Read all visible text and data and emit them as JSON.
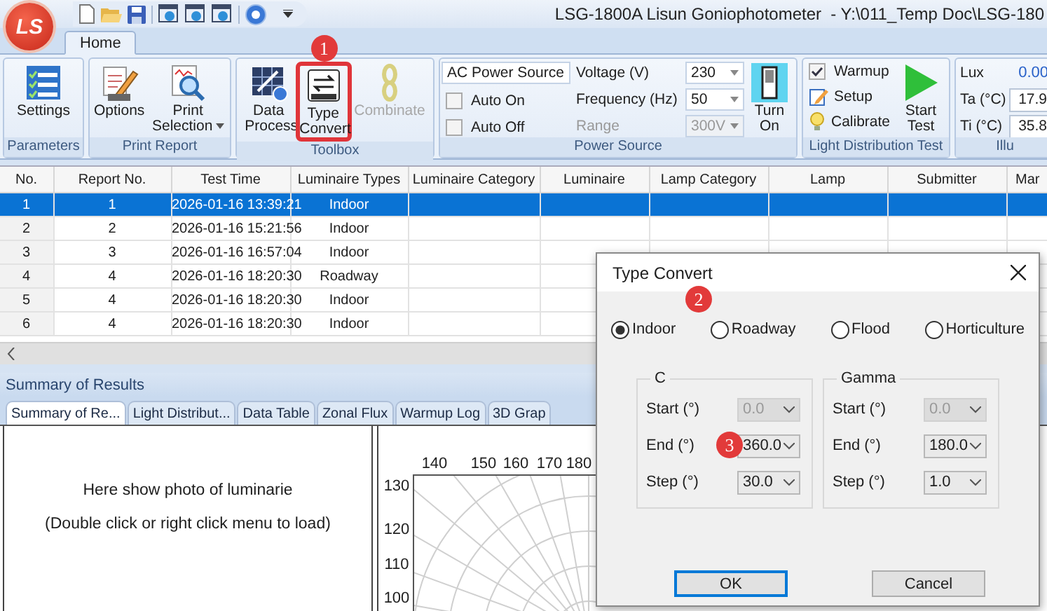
{
  "title_bar": {
    "logo": "LS",
    "title": "LSG-1800A Lisun Goniophotometer  - Y:\\011_Temp Doc\\LSG-180"
  },
  "ribbon_tabs": [
    {
      "label": "Home",
      "selected": true
    }
  ],
  "ribbon_groups": [
    {
      "kind": "buttons",
      "label": "Parameters",
      "buttons": [
        {
          "kind": "settings",
          "label": "Settings",
          "disabled": false,
          "dropdown": false,
          "highlighted": false
        }
      ]
    },
    {
      "kind": "buttons",
      "label": "Print Report",
      "buttons": [
        {
          "kind": "options",
          "label": "Options",
          "disabled": false,
          "dropdown": false,
          "highlighted": false
        },
        {
          "kind": "print",
          "label": "Print Selection",
          "disabled": false,
          "dropdown": true,
          "highlighted": false
        }
      ]
    },
    {
      "kind": "buttons",
      "label": "Toolbox",
      "buttons": [
        {
          "kind": "data",
          "label": "Data Process",
          "disabled": false,
          "dropdown": false,
          "highlighted": false
        },
        {
          "kind": "convert",
          "label": "Type Convert",
          "disabled": false,
          "dropdown": false,
          "highlighted": true,
          "badge": "1"
        },
        {
          "kind": "combinate",
          "label": "Combinate",
          "disabled": true,
          "dropdown": false,
          "highlighted": false
        }
      ]
    },
    {
      "kind": "power",
      "label": "Power Source",
      "source": "AC Power Source",
      "checks": [
        {
          "label": "Auto On",
          "checked": false
        },
        {
          "label": "Auto Off",
          "checked": false
        }
      ],
      "fields": [
        {
          "label": "Voltage (V)",
          "value": "230",
          "disabled": false
        },
        {
          "label": "Frequency (Hz)",
          "value": "50",
          "disabled": false
        },
        {
          "label": "Range",
          "value": "300V",
          "disabled": true
        }
      ],
      "switch": {
        "label": "Turn On"
      }
    },
    {
      "kind": "test",
      "label": "Light Distribution Test",
      "items": [
        {
          "kind": "check",
          "label": "Warmup",
          "checked": true
        },
        {
          "kind": "setup",
          "label": "Setup"
        },
        {
          "kind": "calibrate",
          "label": "Calibrate"
        }
      ],
      "start": {
        "label": "Start Test"
      }
    },
    {
      "kind": "readings",
      "label": "Illu",
      "readings": [
        {
          "kind": "plain",
          "label": "Lux",
          "value": "0.00"
        },
        {
          "kind": "boxed",
          "label": "Ta (°C)",
          "value": "17.9"
        },
        {
          "kind": "boxed",
          "label": "Ti (°C)",
          "value": "35.8"
        }
      ]
    }
  ],
  "table": {
    "columns": [
      "No.",
      "Report No.",
      "Test Time",
      "Luminaire Types",
      "Luminaire Category",
      "Luminaire",
      "Lamp Category",
      "Lamp",
      "Submitter",
      "Mar"
    ],
    "rows": [
      {
        "selected": true,
        "cells": [
          "1",
          "1",
          "2026-01-16 13:39:21",
          "Indoor"
        ]
      },
      {
        "selected": false,
        "cells": [
          "2",
          "2",
          "2026-01-16 15:21:56",
          "Indoor"
        ]
      },
      {
        "selected": false,
        "cells": [
          "3",
          "3",
          "2026-01-16 16:57:04",
          "Indoor"
        ]
      },
      {
        "selected": false,
        "cells": [
          "4",
          "4",
          "2026-01-16 18:20:30",
          "Roadway"
        ]
      },
      {
        "selected": false,
        "cells": [
          "5",
          "4",
          "2026-01-16 18:20:30",
          "Indoor"
        ]
      },
      {
        "selected": false,
        "cells": [
          "6",
          "4",
          "2026-01-16 18:20:30",
          "Indoor"
        ]
      }
    ]
  },
  "summary": {
    "title": "Summary of Results",
    "tabs": [
      {
        "label": "Summary of Re...",
        "selected": true
      },
      {
        "label": "Light Distribut...",
        "selected": false
      },
      {
        "label": "Data Table",
        "selected": false
      },
      {
        "label": "Zonal Flux",
        "selected": false
      },
      {
        "label": "Warmup Log",
        "selected": false
      },
      {
        "label": "3D Grap",
        "selected": false
      }
    ],
    "photo_panel": {
      "lines": [
        "Here show photo of luminarie",
        "(Double click or right click menu to load)"
      ]
    },
    "polar": {
      "top_ticks": [
        "140",
        "150",
        "160",
        "170",
        "180"
      ],
      "left_ticks": [
        "130",
        "120",
        "110",
        "100"
      ]
    }
  },
  "dialog": {
    "title": "Type Convert",
    "options_badge": "2",
    "options": [
      {
        "label": "Indoor",
        "selected": true
      },
      {
        "label": "Roadway",
        "selected": false
      },
      {
        "label": "Flood",
        "selected": false
      },
      {
        "label": "Horticulture",
        "selected": false
      }
    ],
    "groups": [
      {
        "title": "C",
        "fields": [
          {
            "label": "Start (°)",
            "value": "0.0",
            "disabled": true
          },
          {
            "label": "End (°)",
            "value": "360.0",
            "disabled": false,
            "badge": "3"
          },
          {
            "label": "Step (°)",
            "value": "30.0",
            "disabled": false
          }
        ]
      },
      {
        "title": "Gamma",
        "fields": [
          {
            "label": "Start (°)",
            "value": "0.0",
            "disabled": true
          },
          {
            "label": "End (°)",
            "value": "180.0",
            "disabled": false
          },
          {
            "label": "Step (°)",
            "value": "1.0",
            "disabled": false
          }
        ]
      }
    ],
    "buttons": [
      {
        "label": "OK",
        "default": true
      },
      {
        "label": "Cancel",
        "default": false
      }
    ]
  }
}
